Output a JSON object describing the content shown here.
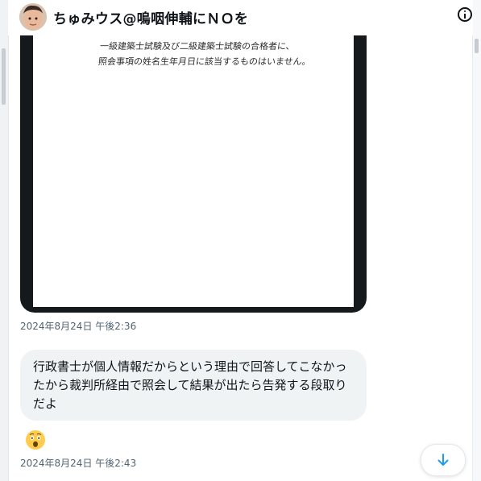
{
  "header": {
    "title": "ちゅみウス@嗚咽伸輔にＮＯを",
    "avatar_icon": "user-avatar",
    "info_icon": "info-icon"
  },
  "messages": {
    "image": {
      "handwriting_lines": [
        "一級建築士試験及び二級建築士試験の合格者に、",
        "照会事項の姓名生年月日に該当するものはいません。"
      ],
      "timestamp": "2024年8月24日 午後2:36"
    },
    "text": {
      "body": "行政書士が個人情報だからという理由で回答してこなかったから裁判所経由で照会して結果が出たら告発する段取りだよ",
      "reaction": "😲",
      "timestamp": "2024年8月24日 午後2:43"
    }
  },
  "controls": {
    "scroll_down_icon": "arrow-down-icon"
  },
  "colors": {
    "bubble": "#eff3f4",
    "timestamp": "#536471",
    "accent": "#1d9bf0"
  }
}
